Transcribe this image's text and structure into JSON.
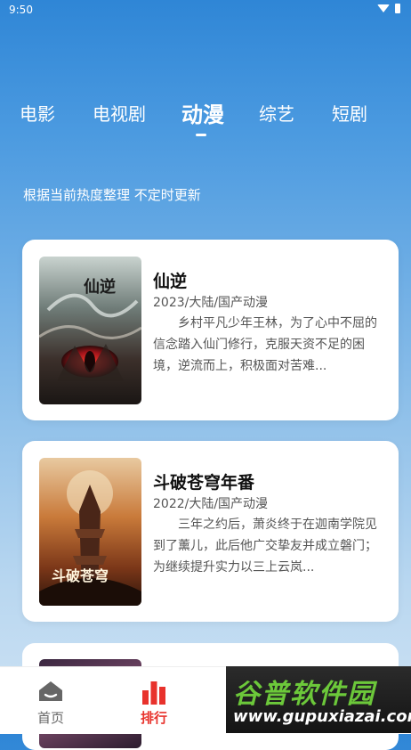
{
  "status": {
    "time": "9:50"
  },
  "tabs": [
    {
      "label": "电影",
      "active": false
    },
    {
      "label": "电视剧",
      "active": false
    },
    {
      "label": "动漫",
      "active": true
    },
    {
      "label": "综艺",
      "active": false
    },
    {
      "label": "短剧",
      "active": false
    }
  ],
  "subtitle": "根据当前热度整理 不定时更新",
  "cards": [
    {
      "poster_text": "仙逆",
      "title": "仙逆",
      "meta": "2023/大陆/国产动漫",
      "desc": "乡村平凡少年王林，为了心中不屈的信念踏入仙门修行，克服天资不足的困境，逆流而上，积极面对苦难..."
    },
    {
      "poster_text": "斗破苍穹",
      "title": "斗破苍穹年番",
      "meta": "2022/大陆/国产动漫",
      "desc": "三年之约后，萧炎终于在迦南学院见到了薰儿，此后他广交挚友并成立磐门；为继续提升实力以三上云岚..."
    }
  ],
  "bottom_nav": [
    {
      "label": "首页",
      "icon": "home-icon",
      "active": false
    },
    {
      "label": "排行",
      "icon": "ranking-icon",
      "active": true
    }
  ],
  "watermark": {
    "main": "谷普软件园",
    "url": "www.gupuxiazai.com"
  },
  "colors": {
    "accent": "#e8322c",
    "inactive": "#666666",
    "brand_green": "#6cc83a"
  }
}
